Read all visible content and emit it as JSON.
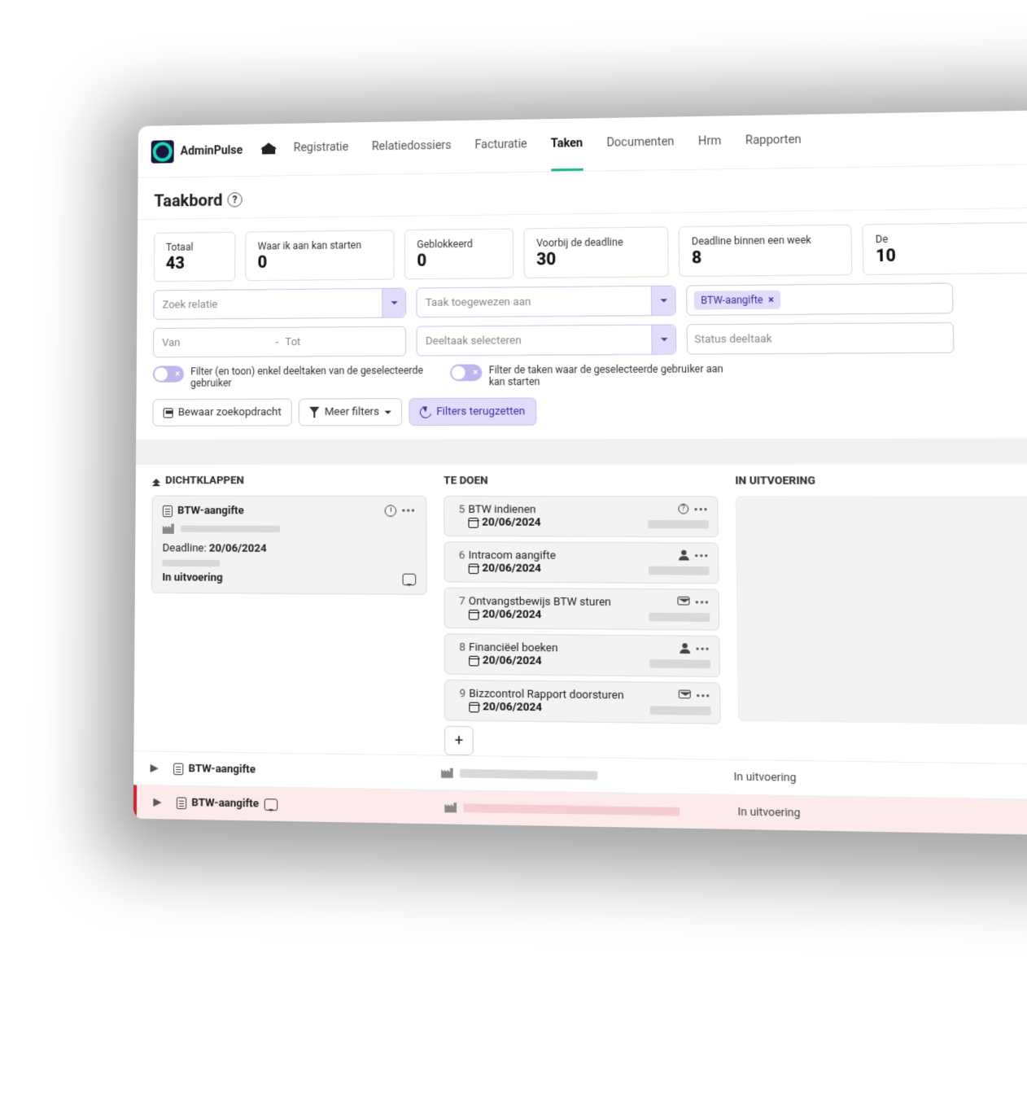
{
  "brand": {
    "name": "AdminPulse"
  },
  "nav": {
    "items": [
      {
        "label": "Registratie",
        "active": false
      },
      {
        "label": "Relatiedossiers",
        "active": false
      },
      {
        "label": "Facturatie",
        "active": false
      },
      {
        "label": "Taken",
        "active": true
      },
      {
        "label": "Documenten",
        "active": false
      },
      {
        "label": "Hrm",
        "active": false
      },
      {
        "label": "Rapporten",
        "active": false
      }
    ]
  },
  "page": {
    "title": "Taakbord"
  },
  "stats": [
    {
      "label": "Totaal",
      "value": "43"
    },
    {
      "label": "Waar ik aan kan starten",
      "value": "0"
    },
    {
      "label": "Geblokkeerd",
      "value": "0"
    },
    {
      "label": "Voorbij de deadline",
      "value": "30"
    },
    {
      "label": "Deadline binnen een week",
      "value": "8"
    },
    {
      "label": "De",
      "value": "10"
    }
  ],
  "filters": {
    "relation_placeholder": "Zoek relatie",
    "assigned_placeholder": "Taak toegewezen aan",
    "chip_tasktype": "BTW-aangifte",
    "date_from": "Van",
    "date_sep": "-",
    "date_to": "Tot",
    "subtask_placeholder": "Deeltaak selecteren",
    "substatus_placeholder": "Status deeltaak",
    "toggle1_label": "Filter (en toon) enkel deeltaken van de geselecteerde gebruiker",
    "toggle2_label": "Filter de taken waar de geselecteerde gebruiker aan kan starten",
    "save_label": "Bewaar zoekopdracht",
    "more_label": "Meer filters",
    "reset_label": "Filters terugzetten"
  },
  "board": {
    "collapse_label": "DICHTKLAPPEN",
    "col_todo": "TE DOEN",
    "col_doing": "IN UITVOERING",
    "task": {
      "title": "BTW-aangifte",
      "deadline_label": "Deadline:",
      "deadline": "20/06/2024",
      "status": "In uitvoering"
    },
    "subtasks": [
      {
        "num": "5",
        "title": "BTW indienen",
        "deadline": "20/06/2024",
        "icon": "question"
      },
      {
        "num": "6",
        "title": "Intracom aangifte",
        "deadline": "20/06/2024",
        "icon": "user"
      },
      {
        "num": "7",
        "title": "Ontvangstbewijs BTW sturen",
        "deadline": "20/06/2024",
        "icon": "mail"
      },
      {
        "num": "8",
        "title": "Financiëel boeken",
        "deadline": "20/06/2024",
        "icon": "user"
      },
      {
        "num": "9",
        "title": "Bizzcontrol Rapport doorsturen",
        "deadline": "20/06/2024",
        "icon": "mail"
      }
    ],
    "collapsed": [
      {
        "title": "BTW-aangifte",
        "status": "In uitvoering",
        "red": false
      },
      {
        "title": "BTW-aangifte",
        "status": "In uitvoering",
        "red": true
      }
    ]
  }
}
